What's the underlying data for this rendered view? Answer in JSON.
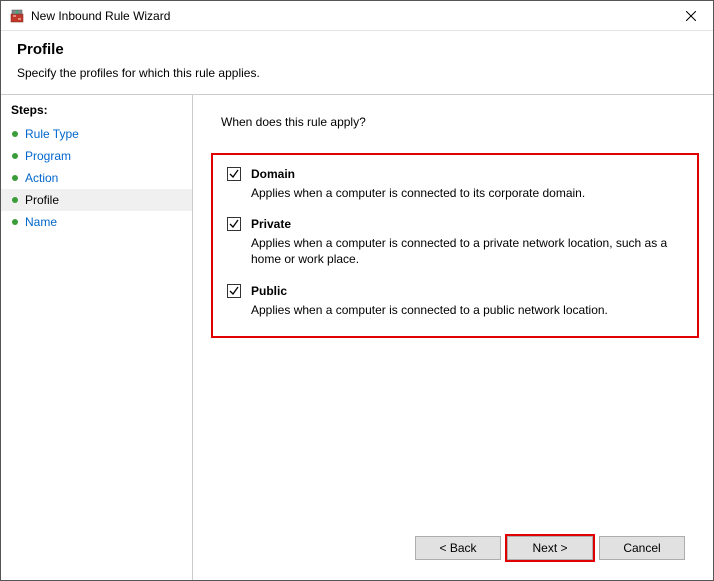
{
  "titlebar": {
    "title": "New Inbound Rule Wizard"
  },
  "header": {
    "title": "Profile",
    "subtitle": "Specify the profiles for which this rule applies."
  },
  "sidebar": {
    "steps_label": "Steps:",
    "items": [
      {
        "label": "Rule Type"
      },
      {
        "label": "Program"
      },
      {
        "label": "Action"
      },
      {
        "label": "Profile"
      },
      {
        "label": "Name"
      }
    ]
  },
  "main": {
    "prompt": "When does this rule apply?",
    "options": [
      {
        "label": "Domain",
        "description": "Applies when a computer is connected to its corporate domain."
      },
      {
        "label": "Private",
        "description": "Applies when a computer is connected to a private network location, such as a home or work place."
      },
      {
        "label": "Public",
        "description": "Applies when a computer is connected to a public network location."
      }
    ]
  },
  "buttons": {
    "back": "< Back",
    "next": "Next >",
    "cancel": "Cancel"
  }
}
